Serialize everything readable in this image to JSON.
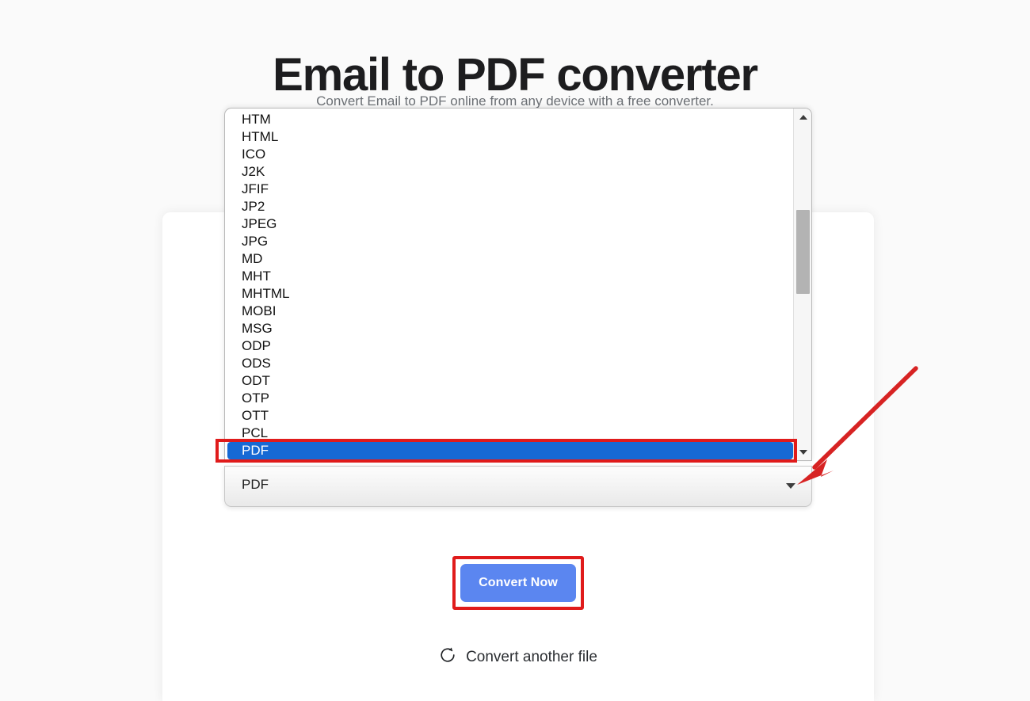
{
  "header": {
    "title": "Email to PDF converter",
    "subtitle": "Convert Email to PDF online from any device with a free converter."
  },
  "format_select": {
    "selected_value": "PDF",
    "caret_icon": "chevron-down-icon",
    "open": true,
    "options": [
      "HTM",
      "HTML",
      "ICO",
      "J2K",
      "JFIF",
      "JP2",
      "JPEG",
      "JPG",
      "MD",
      "MHT",
      "MHTML",
      "MOBI",
      "MSG",
      "ODP",
      "ODS",
      "ODT",
      "OTP",
      "OTT",
      "PCL",
      "PDF"
    ],
    "highlighted_option": "PDF",
    "scrollbar": {
      "up_arrow_icon": "triangle-up-icon",
      "down_arrow_icon": "triangle-down-icon"
    }
  },
  "actions": {
    "convert_label": "Convert Now",
    "convert_another_label": "Convert another file",
    "convert_another_icon": "refresh-icon"
  },
  "annotations": {
    "highlight_color": "#e01b1b",
    "arrow_color": "#d72323"
  },
  "colors": {
    "page_background": "#fafafa",
    "card_background": "#ffffff",
    "primary_button": "#5b86f0",
    "selection_blue": "#1669d4",
    "title_text": "#1d1d1f",
    "subtitle_text": "#6b6f74"
  }
}
